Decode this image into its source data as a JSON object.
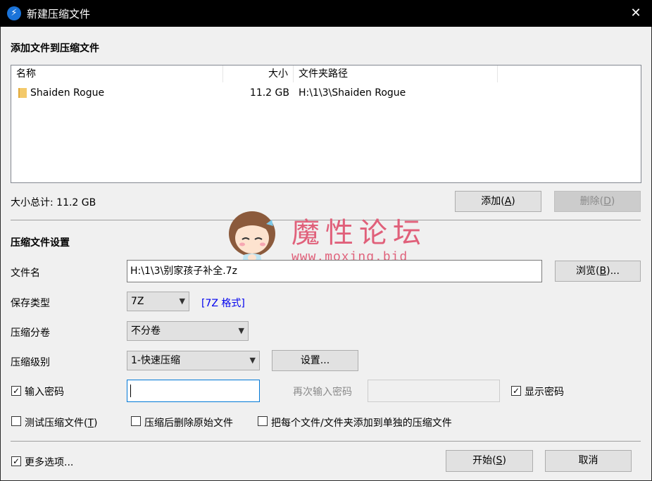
{
  "window": {
    "title": "新建压缩文件",
    "close_glyph": "✕"
  },
  "add_section": {
    "title": "添加文件到压缩文件",
    "columns": [
      "名称",
      "大小",
      "文件夹路径"
    ],
    "rows": [
      {
        "name": "Shaiden Rogue",
        "size": "11.2 GB",
        "path": "H:\\1\\3\\Shaiden Rogue"
      }
    ],
    "total": "大小总计: 11.2 GB",
    "add_button": {
      "label": "添加(",
      "key": "A",
      "end": ")"
    },
    "delete_button": {
      "label": "删除(",
      "key": "D",
      "end": ")"
    }
  },
  "settings": {
    "title": "压缩文件设置",
    "filename_label": "文件名",
    "filename_value": "H:\\1\\3\\别家孩子补全.7z",
    "browse_button": {
      "label": "浏览(",
      "key": "B",
      "end": ")..."
    },
    "save_type_label": "保存类型",
    "save_type_value": "7Z",
    "format_link": "[7Z 格式]",
    "split_label": "压缩分卷",
    "split_value": "不分卷",
    "level_label": "压缩级别",
    "level_value": "1-快速压缩",
    "settings_button": "设置...",
    "password_label": "输入密码",
    "password_checked": true,
    "reenter_label": "再次输入密码",
    "show_password_label": "显示密码",
    "show_password_checked": true,
    "test_label": {
      "label": "测试压缩文件(",
      "key": "T",
      "end": ")"
    },
    "delete_after_label": "压缩后删除原始文件",
    "each_separate_label": "把每个文件/文件夹添加到单独的压缩文件"
  },
  "footer": {
    "more_options_label": "更多选项...",
    "more_options_checked": true,
    "start_button": {
      "label": "开始(",
      "key": "S",
      "end": ")"
    },
    "cancel_button": "取消"
  },
  "watermark": {
    "text": "魔性论坛",
    "url": "www.moxing.bid"
  },
  "colors": {
    "accent_link": "#0000ee",
    "watermark": "#e0607a",
    "titlebar": "#000000"
  }
}
